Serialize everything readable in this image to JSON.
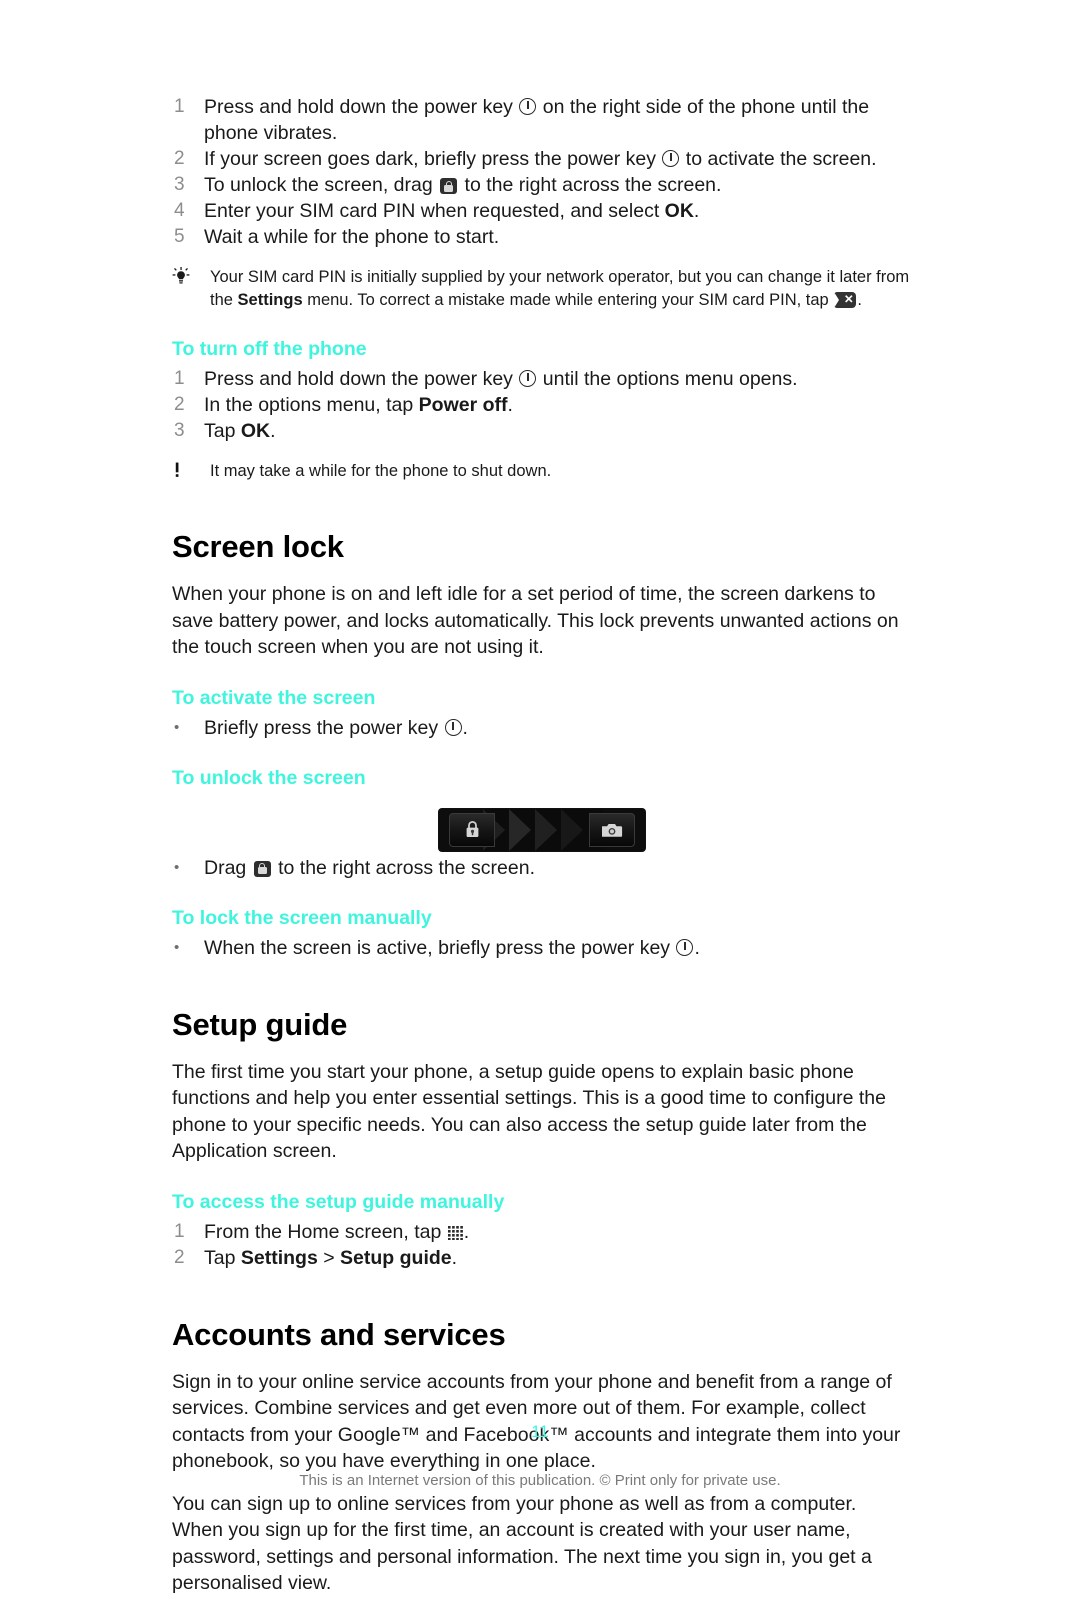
{
  "page": {
    "number": "11",
    "footer_note": "This is an Internet version of this publication. © Print only for private use.",
    "accent_color": "#3ff5dd"
  },
  "startup_steps": {
    "items": [
      {
        "num": "1",
        "pre": "Press and hold down the power key ",
        "icon": "power-key-icon",
        "post": " on the right side of the phone until the phone vibrates."
      },
      {
        "num": "2",
        "pre": "If your screen goes dark, briefly press the power key ",
        "icon": "power-key-icon",
        "post": " to activate the screen."
      },
      {
        "num": "3",
        "pre": "To unlock the screen, drag ",
        "icon": "lock-chip-icon",
        "post": " to the right across the screen."
      },
      {
        "num": "4",
        "pre": "Enter your SIM card PIN when requested, and select ",
        "bold": "OK",
        "post": "."
      },
      {
        "num": "5",
        "pre": "Wait a while for the phone to start."
      }
    ]
  },
  "tip_sim_pin": {
    "icon": "tip-lightbulb-icon",
    "part1": "Your SIM card PIN is initially supplied by your network operator, but you can change it later from the ",
    "bold1": "Settings",
    "part2": " menu. To correct a mistake made while entering your SIM card PIN, tap ",
    "icon2": "delete-key-icon",
    "part3": "."
  },
  "turn_off": {
    "heading": "To turn off the phone",
    "items": [
      {
        "num": "1",
        "pre": "Press and hold down the power key ",
        "icon": "power-key-icon",
        "post": " until the options menu opens."
      },
      {
        "num": "2",
        "pre": "In the options menu, tap ",
        "bold": "Power off",
        "post": "."
      },
      {
        "num": "3",
        "pre": "Tap ",
        "bold": "OK",
        "post": "."
      }
    ],
    "warning": {
      "icon": "warning-exclamation-icon",
      "text": "It may take a while for the phone to shut down."
    }
  },
  "screen_lock": {
    "heading": "Screen lock",
    "intro": "When your phone is on and left idle for a set period of time, the screen darkens to save battery power, and locks automatically. This lock prevents unwanted actions on the touch screen when you are not using it.",
    "activate": {
      "heading": "To activate the screen",
      "bullet": "•",
      "pre": "Briefly press the power key ",
      "icon": "power-key-icon",
      "post": "."
    },
    "unlock": {
      "heading": "To unlock the screen",
      "figure": {
        "name": "lockscreen-slider-figure",
        "left_icon": "padlock-icon",
        "right_icon": "camera-icon",
        "chevron_count": "3"
      },
      "bullet": "•",
      "pre": "Drag ",
      "icon": "lock-chip-icon",
      "post": " to the right across the screen."
    },
    "lock_manually": {
      "heading": "To lock the screen manually",
      "bullet": "•",
      "pre": "When the screen is active, briefly press the power key ",
      "icon": "power-key-icon",
      "post": "."
    }
  },
  "setup_guide": {
    "heading": "Setup guide",
    "intro": "The first time you start your phone, a setup guide opens to explain basic phone functions and help you enter essential settings. This is a good time to configure the phone to your specific needs. You can also access the setup guide later from the Application screen.",
    "access": {
      "heading": "To access the setup guide manually",
      "items": [
        {
          "num": "1",
          "pre": "From the Home screen, tap ",
          "icon": "app-drawer-grid-icon",
          "post": "."
        },
        {
          "num": "2",
          "pre": "Tap ",
          "bold": "Settings",
          "mid": " > ",
          "bold2": "Setup guide",
          "post": "."
        }
      ]
    }
  },
  "accounts": {
    "heading": "Accounts and services",
    "para1": "Sign in to your online service accounts from your phone and benefit from a range of services. Combine services and get even more out of them. For example, collect contacts from your Google™ and Facebook™ accounts and integrate them into your phonebook, so you have everything in one place.",
    "para2": "You can sign up to online services from your phone as well as from a computer. When you sign up for the first time, an account is created with your user name, password, settings and personal information. The next time you sign in, you get a personalised view."
  }
}
